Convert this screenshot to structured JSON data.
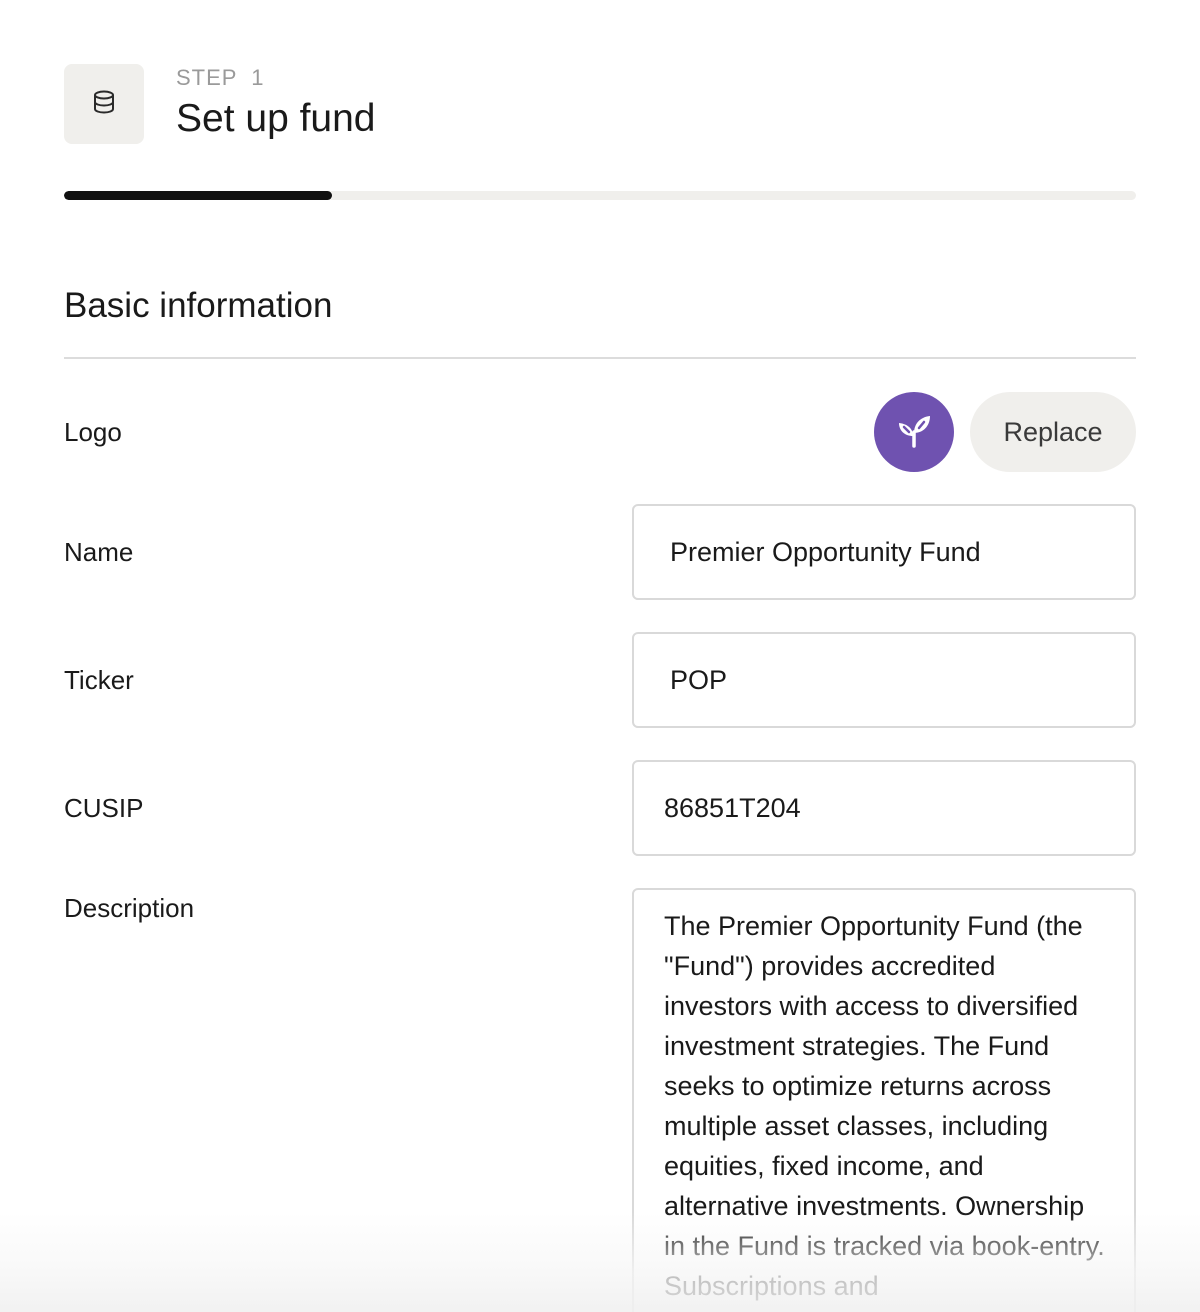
{
  "header": {
    "step_label": "STEP  1",
    "title": "Set up fund",
    "icon": "database-icon"
  },
  "progress": {
    "value_percent": 25
  },
  "section": {
    "title": "Basic information"
  },
  "fields": {
    "logo": {
      "label": "Logo",
      "icon": "sprout-icon",
      "color": "#6f52b0",
      "replace_label": "Replace"
    },
    "name": {
      "label": "Name",
      "value": "Premier Opportunity Fund"
    },
    "ticker": {
      "label": "Ticker",
      "value": "POP"
    },
    "cusip": {
      "label": "CUSIP",
      "value": "86851T204"
    },
    "description": {
      "label": "Description",
      "value": "The Premier Opportunity Fund (the \"Fund\") provides accredited investors with access to diversified investment strategies. The Fund seeks to optimize returns across multiple asset classes, including equities, fixed income, and alternative investments. Ownership in the Fund is tracked via book-entry. Subscriptions and"
    }
  },
  "colors": {
    "accent": "#6f52b0",
    "progress_fill": "#111111",
    "progress_track": "#f0efec"
  }
}
